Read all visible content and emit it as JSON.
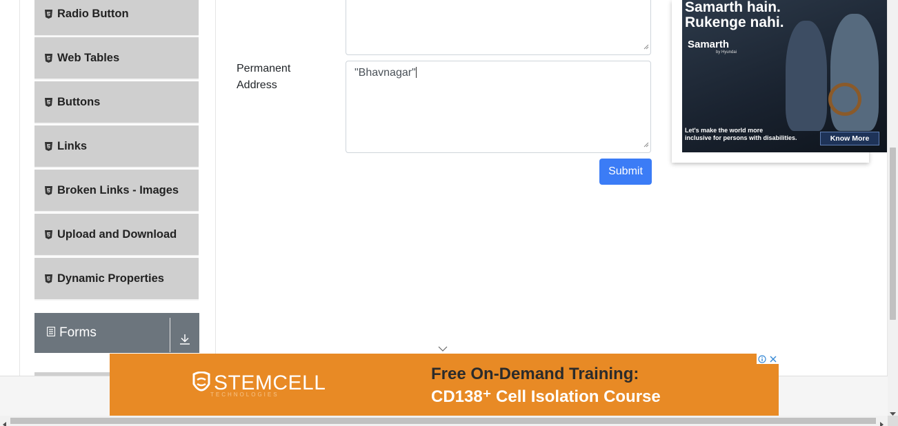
{
  "sidebar": {
    "items": [
      {
        "label": "Radio Button"
      },
      {
        "label": "Web Tables"
      },
      {
        "label": "Buttons"
      },
      {
        "label": "Links"
      },
      {
        "label": "Broken Links - Images"
      },
      {
        "label": "Upload and Download"
      },
      {
        "label": "Dynamic Properties"
      }
    ],
    "group": {
      "label": "Forms",
      "icon": "document-icon",
      "toggle_icon": "download-arrow-icon"
    }
  },
  "form": {
    "permanent_address_label": "Permanent Address",
    "permanent_address_value": "\"Bhavnagar\"",
    "submit_label": "Submit"
  },
  "side_ad": {
    "headline_1": "Samarth hain.",
    "headline_2": "Rukenge nahi.",
    "brand": "Samarth",
    "brand_sub": "by Hyundai",
    "footer_line_1": "Let's make the world more",
    "footer_line_2": "inclusive for persons with disabilities.",
    "cta": "Know More"
  },
  "bottom_ad": {
    "brand": "STEMCELL",
    "brand_tag": "TECHNOLOGIES",
    "line_1": "Free On-Demand Training:",
    "line_2": "CD138⁺ Cell Isolation Course",
    "color": "#e88a25"
  }
}
